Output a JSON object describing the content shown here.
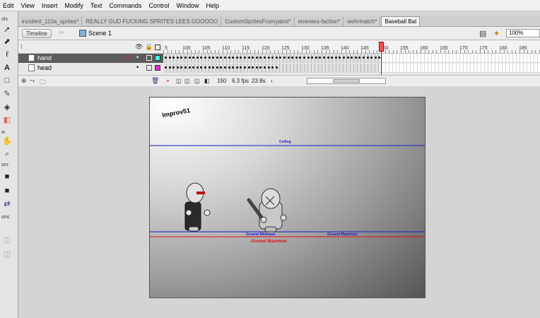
{
  "menu": [
    "Edit",
    "View",
    "Insert",
    "Modify",
    "Text",
    "Commands",
    "Control",
    "Window",
    "Help"
  ],
  "tools": {
    "labels": [
      "ols",
      "w",
      "ors",
      "ons"
    ],
    "icon_names": [
      "arrow-icon",
      "subselect-icon",
      "lasso-icon",
      "text-icon",
      "rectangle-icon",
      "brush-icon",
      "paint-bucket-icon",
      "eraser-icon",
      "hand-icon",
      "zoom-icon",
      "stroke-color-icon",
      "fill-color-icon",
      "swap-colors-icon",
      "snap-icon",
      "smooth-icon"
    ]
  },
  "tabs": [
    {
      "label": "incident_110a_sprites*",
      "active": false
    },
    {
      "label": "REALLY GUD FUCKING SPRITES LEES GOOOOO",
      "active": false
    },
    {
      "label": "CustomSpritesFromyaboi*",
      "active": false
    },
    {
      "label": "enemies-faction*",
      "active": false
    },
    {
      "label": "wehrmatch*",
      "active": false
    },
    {
      "label": "Baseball Bat",
      "active": true
    }
  ],
  "scenebar": {
    "timeline_label": "Timeline",
    "scene_label": "Scene 1",
    "zoom": "100%"
  },
  "layers": [
    {
      "name": "hand",
      "selected": true,
      "swatch_color": "#33ffee"
    },
    {
      "name": "head",
      "selected": false,
      "swatch_color": "#ee22dd"
    }
  ],
  "ruler_numbers": [
    "5",
    "100",
    "105",
    "110",
    "115",
    "120",
    "125",
    "130",
    "135",
    "140",
    "145",
    "150",
    "155",
    "160",
    "165",
    "170",
    "175",
    "180",
    "185"
  ],
  "timeline_footer": {
    "current_frame": "150",
    "fps": "6.3 fps",
    "elapsed": "23.8s"
  },
  "stage": {
    "watermark": "Improv51",
    "ceiling_label": "Ground Maximum",
    "ceiling_top_label": "Ceiling",
    "ground_min_label": "Ground Minimum",
    "ground_max_label": "Ground Maximum",
    "ground_max_red_label": "Ground Maximum",
    "colors": {
      "guide_blue": "#1a1acc",
      "guide_red": "#dd1111",
      "playhead": "#ff4a4a"
    }
  }
}
